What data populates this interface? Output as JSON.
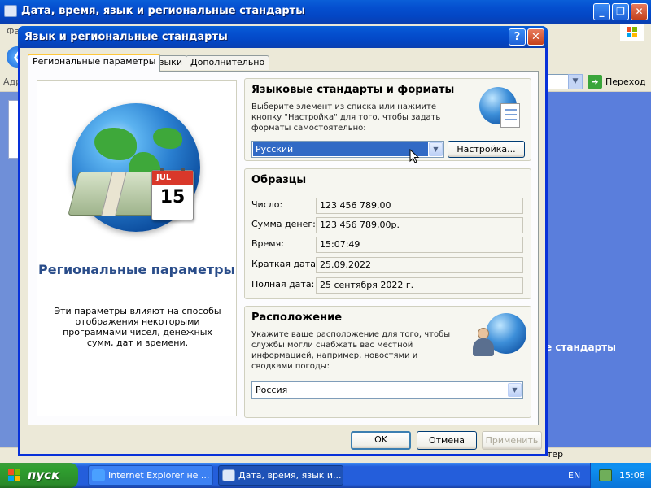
{
  "background_window": {
    "title": "Дата, время, язык и региональные стандарты",
    "menu_text": "Фа",
    "address_label": "Адр",
    "go_label": "Переход",
    "right_pane_text": "е стандарты",
    "status_text": "тер"
  },
  "dialog": {
    "title": "Язык и региональные стандарты",
    "help_label": "?",
    "close_label": "✕",
    "tabs": [
      {
        "label": "Региональные параметры",
        "active": true
      },
      {
        "label": "Языки",
        "active": false
      },
      {
        "label": "Дополнительно",
        "active": false
      }
    ],
    "info": {
      "calendar_month": "JUL",
      "calendar_day": "15",
      "title": "Региональные параметры",
      "description": "Эти параметры влияют на способы отображения некоторыми программами чисел, денежных сумм, дат и времени."
    },
    "standards": {
      "title": "Языковые стандарты и форматы",
      "description": "Выберите элемент из списка или нажмите кнопку \"Настройка\" для того, чтобы задать форматы самостоятельно:",
      "selected": "Русский",
      "customize_label": "Настройка..."
    },
    "samples": {
      "title": "Образцы",
      "rows": [
        {
          "label": "Число:",
          "value": "123 456 789,00"
        },
        {
          "label": "Сумма денег:",
          "value": "123 456 789,00р."
        },
        {
          "label": "Время:",
          "value": "15:07:49"
        },
        {
          "label": "Краткая дата:",
          "value": "25.09.2022"
        },
        {
          "label": "Полная дата:",
          "value": "25 сентября 2022 г."
        }
      ]
    },
    "location": {
      "title": "Расположение",
      "description": "Укажите ваше расположение для того, чтобы службы могли снабжать вас местной информацией, например, новостями и сводками погоды:",
      "selected": "Россия"
    },
    "buttons": {
      "ok": "OK",
      "cancel": "Отмена",
      "apply": "Применить"
    }
  },
  "taskbar": {
    "start_label": "пуск",
    "tasks": [
      {
        "label": "Internet Explorer не ...",
        "active": false
      },
      {
        "label": "Дата, время, язык и...",
        "active": true
      }
    ],
    "language": "EN",
    "clock": "15:08"
  },
  "colors": {
    "titlebar": "#0550d0",
    "selection": "#316ac5",
    "dialog_bg": "#ece9d8",
    "info_title": "#2a4d8a"
  }
}
